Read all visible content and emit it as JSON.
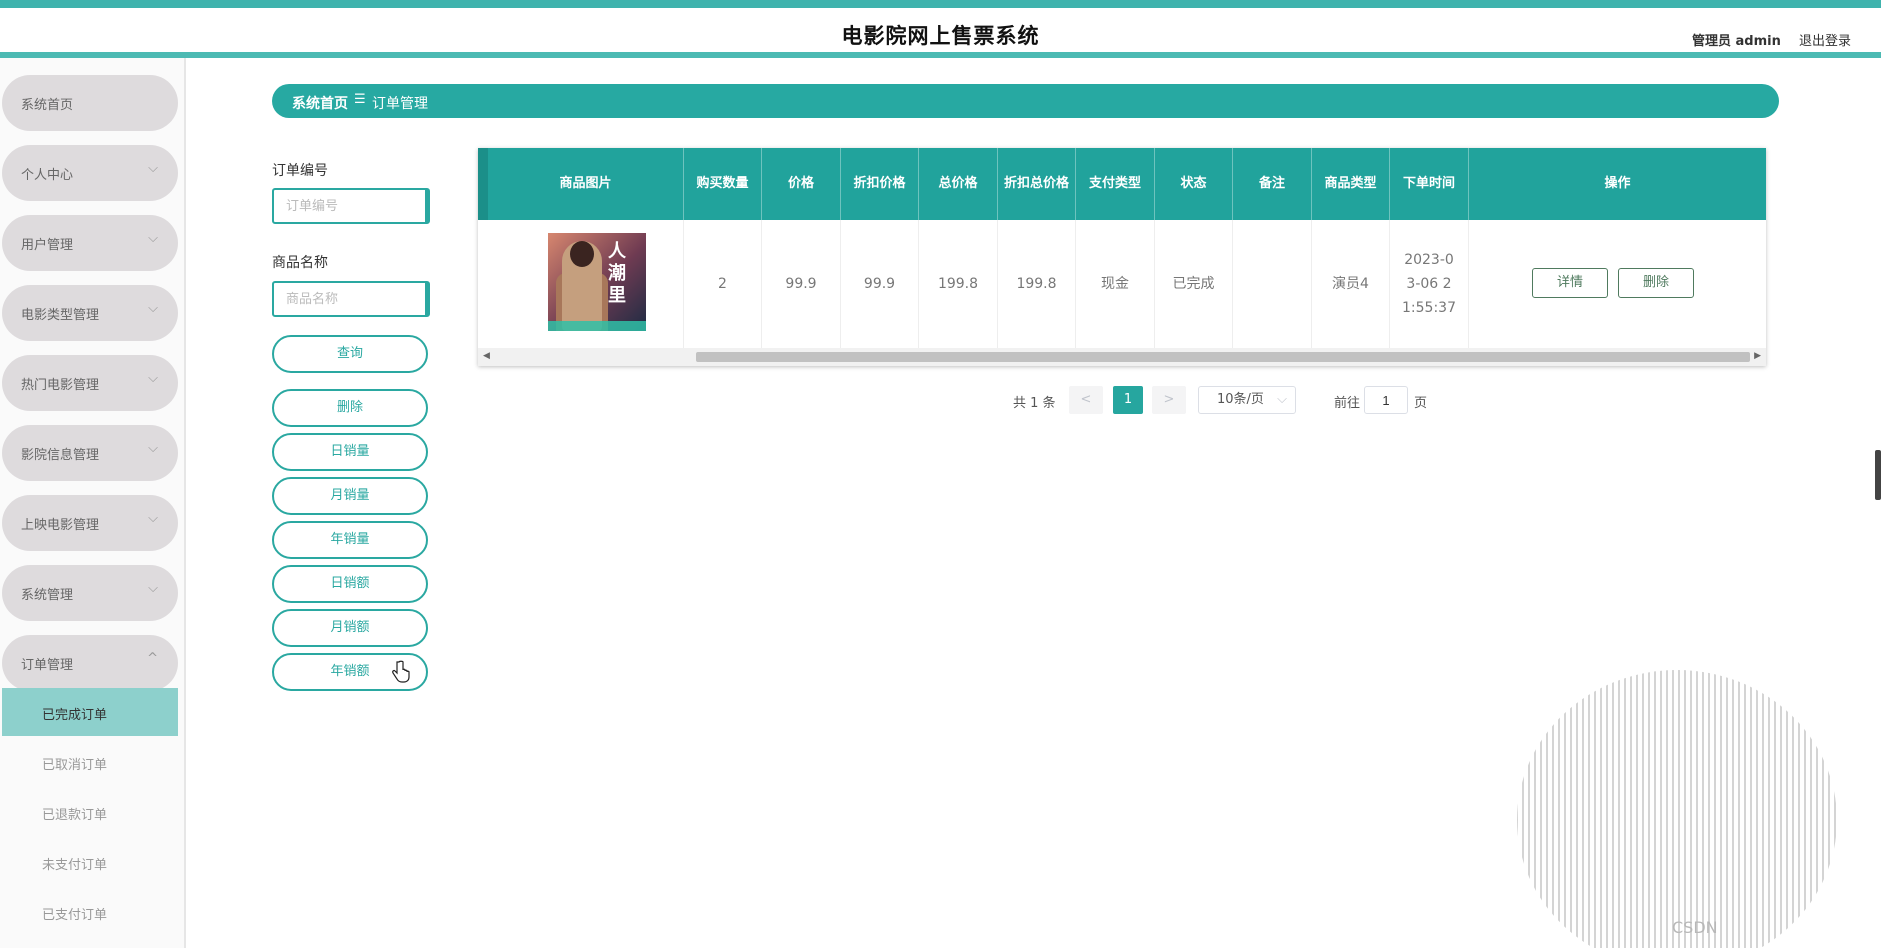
{
  "header": {
    "title": "电影院网上售票系统",
    "admin": "管理员 admin",
    "logout": "退出登录"
  },
  "sidebar": {
    "items": [
      {
        "label": "系统首页"
      },
      {
        "label": "个人中心"
      },
      {
        "label": "用户管理"
      },
      {
        "label": "电影类型管理"
      },
      {
        "label": "热门电影管理"
      },
      {
        "label": "影院信息管理"
      },
      {
        "label": "上映电影管理"
      },
      {
        "label": "系统管理"
      },
      {
        "label": "订单管理"
      }
    ],
    "submenu": [
      {
        "label": "已完成订单",
        "active": true
      },
      {
        "label": "已取消订单"
      },
      {
        "label": "已退款订单"
      },
      {
        "label": "未支付订单"
      },
      {
        "label": "已支付订单"
      }
    ]
  },
  "breadcrumb": {
    "home": "系统首页",
    "separator": "☰",
    "current": "订单管理"
  },
  "search": {
    "order_no_label": "订单编号",
    "order_no_placeholder": "订单编号",
    "product_name_label": "商品名称",
    "product_name_placeholder": "商品名称",
    "buttons": {
      "query": "查询",
      "delete": "删除",
      "daily_sales_qty": "日销量",
      "monthly_sales_qty": "月销量",
      "yearly_sales_qty": "年销量",
      "daily_sales_amt": "日销额",
      "monthly_sales_amt": "月销额",
      "yearly_sales_amt": "年销额"
    }
  },
  "table": {
    "columns": [
      "商品图片",
      "购买数量",
      "价格",
      "折扣价格",
      "总价格",
      "折扣总价格",
      "支付类型",
      "状态",
      "备注",
      "商品类型",
      "下单时间",
      "操作"
    ],
    "rows": [
      {
        "poster_title": "人潮里",
        "quantity": "2",
        "price": "99.9",
        "discount_price": "99.9",
        "total_price": "199.8",
        "discount_total": "199.8",
        "payment_type": "现金",
        "status": "已完成",
        "remark": "",
        "product_type": "演员4",
        "order_time": "2023-03-06 21:55:37",
        "detail_btn": "详情",
        "delete_btn": "删除"
      }
    ]
  },
  "pagination": {
    "total": "共 1 条",
    "prev": "<",
    "page": "1",
    "next": ">",
    "page_size": "10条/页",
    "goto_label": "前往",
    "goto_value": "1",
    "page_suffix": "页"
  },
  "watermark": "CSDN",
  "colors": {
    "accent": "#27a9a2",
    "header_accent": "#3fb3ad",
    "active_submenu": "#8dd0cc"
  }
}
